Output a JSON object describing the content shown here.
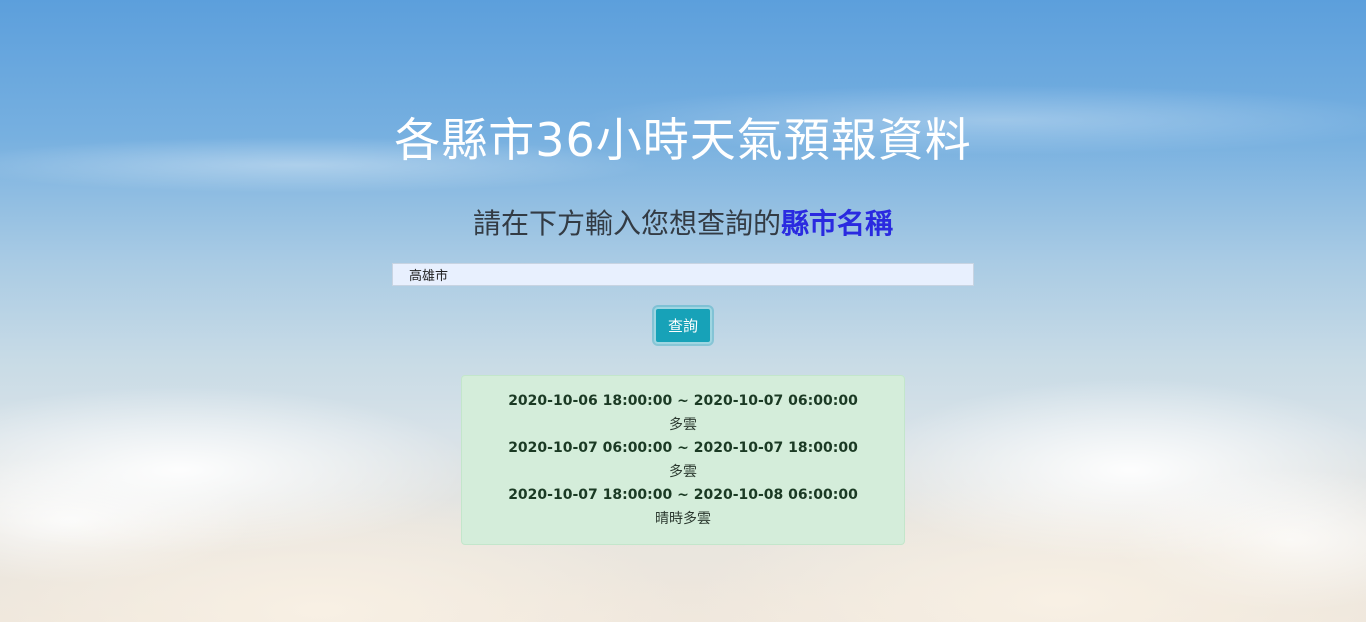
{
  "header": {
    "title": "各縣市36小時天氣預報資料",
    "subtitle_prefix": "請在下方輸入您想查詢的",
    "subtitle_highlight": "縣市名稱"
  },
  "search": {
    "value": "高雄市",
    "button_label": "查詢"
  },
  "forecast": [
    {
      "time_range": "2020-10-06 18:00:00 ~ 2020-10-07 06:00:00",
      "weather": "多雲"
    },
    {
      "time_range": "2020-10-07 06:00:00 ~ 2020-10-07 18:00:00",
      "weather": "多雲"
    },
    {
      "time_range": "2020-10-07 18:00:00 ~ 2020-10-08 06:00:00",
      "weather": "晴時多雲"
    }
  ],
  "colors": {
    "button": "#17a2b8",
    "panel_bg": "#d4edda",
    "highlight": "#2a2ae0"
  }
}
